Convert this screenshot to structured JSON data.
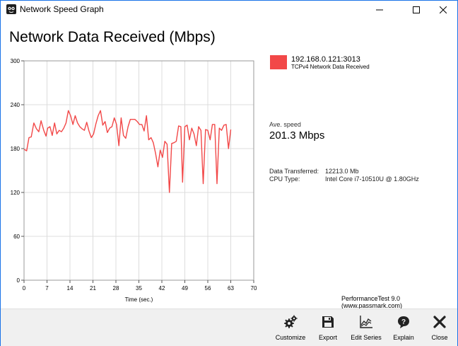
{
  "window": {
    "title": "Network Speed Graph",
    "icon": "passmark-icon",
    "controls": [
      "minimize-icon",
      "maximize-icon",
      "close-icon"
    ]
  },
  "heading": "Network Data Received (Mbps)",
  "legend": {
    "name": "192.168.0.121:3013",
    "description": "TCPv4 Network Data Received",
    "color": "#f24848"
  },
  "stats": {
    "ave_label": "Ave. speed",
    "ave_value": "201.3 Mbps",
    "transferred_label": "Data Transferred:",
    "transferred_value": "12213.0 Mb",
    "cpu_label": "CPU Type:",
    "cpu_value": "Intel Core i7-10510U @ 1.80GHz"
  },
  "credit": "PerformanceTest 9.0 (www.passmark.com)",
  "toolbar": {
    "buttons": [
      {
        "label": "Customize",
        "icon": "gears-icon"
      },
      {
        "label": "Export",
        "icon": "floppy-disk-icon"
      },
      {
        "label": "Edit Series",
        "icon": "line-chart-icon"
      },
      {
        "label": "Explain",
        "icon": "help-bubble-icon"
      },
      {
        "label": "Close",
        "icon": "x-icon"
      }
    ]
  },
  "chart_data": {
    "type": "line",
    "xlabel": "Time (sec.)",
    "ylabel": "",
    "xlim": [
      0,
      70
    ],
    "ylim": [
      0,
      300
    ],
    "xticks": [
      0,
      7,
      14,
      21,
      28,
      35,
      42,
      49,
      56,
      63,
      70
    ],
    "yticks": [
      0,
      60,
      120,
      180,
      240,
      300
    ],
    "grid": true,
    "series": [
      {
        "name": "192.168.0.121:3013",
        "color": "#f24848",
        "points": [
          [
            0,
            179
          ],
          [
            0.8,
            177
          ],
          [
            1.5,
            195
          ],
          [
            2.2,
            196
          ],
          [
            3,
            215
          ],
          [
            3.8,
            207
          ],
          [
            4.5,
            203
          ],
          [
            5.2,
            218
          ],
          [
            6,
            205
          ],
          [
            6.7,
            197
          ],
          [
            7.2,
            208
          ],
          [
            7.9,
            210
          ],
          [
            8.6,
            198
          ],
          [
            9.3,
            215
          ],
          [
            10,
            200
          ],
          [
            10.7,
            205
          ],
          [
            11.4,
            203
          ],
          [
            12.1,
            208
          ],
          [
            12.8,
            215
          ],
          [
            13.5,
            232
          ],
          [
            14.2,
            225
          ],
          [
            14.9,
            213
          ],
          [
            15.6,
            225
          ],
          [
            16.3,
            215
          ],
          [
            17,
            210
          ],
          [
            17.7,
            207
          ],
          [
            18.4,
            205
          ],
          [
            19.1,
            216
          ],
          [
            19.8,
            204
          ],
          [
            20.5,
            195
          ],
          [
            21.2,
            200
          ],
          [
            21.9,
            214
          ],
          [
            22.6,
            225
          ],
          [
            23.3,
            232
          ],
          [
            24,
            212
          ],
          [
            24.7,
            217
          ],
          [
            25.4,
            202
          ],
          [
            26.1,
            208
          ],
          [
            26.8,
            210
          ],
          [
            27.5,
            222
          ],
          [
            28.2,
            213
          ],
          [
            28.9,
            184
          ],
          [
            29.6,
            222
          ],
          [
            30.3,
            198
          ],
          [
            31,
            194
          ],
          [
            31.7,
            210
          ],
          [
            32.4,
            220
          ],
          [
            33.1,
            220
          ],
          [
            33.8,
            220
          ],
          [
            34.5,
            217
          ],
          [
            35.2,
            213
          ],
          [
            35.9,
            213
          ],
          [
            36.6,
            204
          ],
          [
            37.3,
            225
          ],
          [
            38,
            192
          ],
          [
            38.7,
            195
          ],
          [
            39.4,
            188
          ],
          [
            40.1,
            173
          ],
          [
            40.8,
            155
          ],
          [
            41.5,
            178
          ],
          [
            42.2,
            168
          ],
          [
            42.9,
            190
          ],
          [
            43.6,
            186
          ],
          [
            44.3,
            120
          ],
          [
            45,
            187
          ],
          [
            45.7,
            188
          ],
          [
            46.4,
            190
          ],
          [
            47.1,
            211
          ],
          [
            47.8,
            210
          ],
          [
            48.3,
            134
          ],
          [
            49,
            210
          ],
          [
            49.7,
            212
          ],
          [
            50.4,
            192
          ],
          [
            51.1,
            208
          ],
          [
            51.8,
            200
          ],
          [
            52.5,
            184
          ],
          [
            53.2,
            210
          ],
          [
            53.9,
            205
          ],
          [
            54.6,
            132
          ],
          [
            55.3,
            206
          ],
          [
            56,
            205
          ],
          [
            56.7,
            192
          ],
          [
            57.4,
            213
          ],
          [
            58.1,
            213
          ],
          [
            58.8,
            132
          ],
          [
            59.5,
            208
          ],
          [
            60.2,
            205
          ],
          [
            60.9,
            212
          ],
          [
            61.6,
            213
          ],
          [
            62.3,
            180
          ],
          [
            63,
            206
          ]
        ]
      }
    ]
  }
}
